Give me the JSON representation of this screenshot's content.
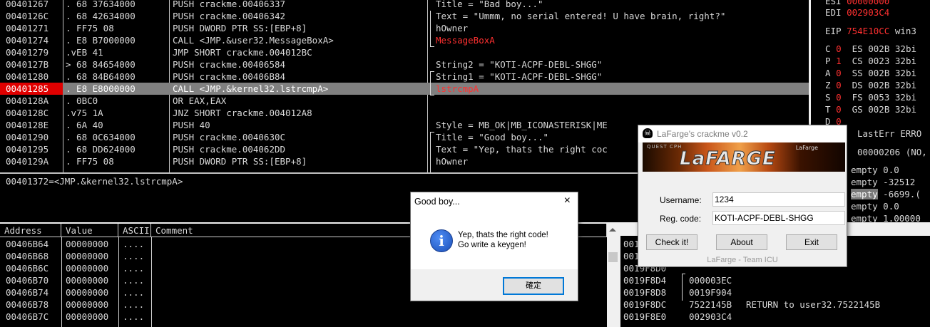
{
  "disasm": {
    "rows": [
      {
        "addr": "00401267",
        "bytes": ". 68 37634000",
        "instr": "PUSH crackme.00406337",
        "comment": "Title = \"Bad boy...\"",
        "comment_red": false
      },
      {
        "addr": "0040126C",
        "bytes": ". 68 42634000",
        "instr": "PUSH crackme.00406342",
        "comment": "Text = \"Ummm, no serial entered! U have brain, right?\"",
        "comment_red": false
      },
      {
        "addr": "00401271",
        "bytes": ". FF75 08",
        "instr": "PUSH DWORD PTR SS:[EBP+8]",
        "comment": "hOwner",
        "comment_red": false
      },
      {
        "addr": "00401274",
        "bytes": ". E8 B7000000",
        "instr": "CALL <JMP.&user32.MessageBoxA>",
        "comment": "MessageBoxA",
        "comment_red": true
      },
      {
        "addr": "00401279",
        "bytes": ".vEB 41",
        "instr": "JMP SHORT crackme.004012BC",
        "comment": "",
        "comment_red": false
      },
      {
        "addr": "0040127B",
        "bytes": "> 68 84654000",
        "instr": "PUSH crackme.00406584",
        "comment": "String2 = \"KOTI-ACPF-DEBL-SHGG\"",
        "comment_red": false
      },
      {
        "addr": "00401280",
        "bytes": ". 68 84B64000",
        "instr": "PUSH crackme.00406B84",
        "comment": "String1 = \"KOTI-ACPF-DEBL-SHGG\"",
        "comment_red": false
      },
      {
        "addr": "00401285",
        "bytes": ". E8 E8000000",
        "instr": "CALL <JMP.&kernel32.lstrcmpA>",
        "comment": "lstrcmpA",
        "comment_red": true
      },
      {
        "addr": "0040128A",
        "bytes": ". 0BC0",
        "instr": "OR EAX,EAX",
        "comment": "",
        "comment_red": false
      },
      {
        "addr": "0040128C",
        "bytes": ".v75 1A",
        "instr": "JNZ SHORT crackme.004012A8",
        "comment": "",
        "comment_red": false
      },
      {
        "addr": "0040128E",
        "bytes": ". 6A 40",
        "instr": "PUSH 40",
        "comment": "Style = MB_OK|MB_ICONASTERISK|ME",
        "comment_red": false
      },
      {
        "addr": "00401290",
        "bytes": ". 68 0C634000",
        "instr": "PUSH crackme.0040630C",
        "comment": "Title = \"Good boy...\"",
        "comment_red": false
      },
      {
        "addr": "00401295",
        "bytes": ". 68 DD624000",
        "instr": "PUSH crackme.004062DD",
        "comment": "Text = \"Yep, thats the right coc",
        "comment_red": false
      },
      {
        "addr": "0040129A",
        "bytes": ". FF75 08",
        "instr": "PUSH DWORD PTR SS:[EBP+8]",
        "comment": "hOwner",
        "comment_red": false
      }
    ],
    "selected_addr": "00401285"
  },
  "info_line": "00401372=<JMP.&kernel32.lstrcmpA>",
  "registers": {
    "lines": [
      {
        "label": "ESI",
        "value": "00000000"
      },
      {
        "label": "EDI",
        "value": "002903C4"
      },
      {
        "label": "EIP",
        "value": "754E10CC",
        "extra": "win3"
      }
    ],
    "flags": [
      {
        "f": "C",
        "v": "0",
        "seg": "ES",
        "sv": "002B",
        "bits": "32bi"
      },
      {
        "f": "P",
        "v": "1",
        "seg": "CS",
        "sv": "0023",
        "bits": "32bi"
      },
      {
        "f": "A",
        "v": "0",
        "seg": "SS",
        "sv": "002B",
        "bits": "32bi"
      },
      {
        "f": "Z",
        "v": "0",
        "seg": "DS",
        "sv": "002B",
        "bits": "32bi"
      },
      {
        "f": "S",
        "v": "0",
        "seg": "FS",
        "sv": "0053",
        "bits": "32bi"
      },
      {
        "f": "T",
        "v": "0",
        "seg": "GS",
        "sv": "002B",
        "bits": "32bi"
      },
      {
        "f": "D",
        "v": "0",
        "seg": "",
        "sv": "",
        "bits": ""
      }
    ],
    "lasterr": "LastErr ERRO",
    "efl": "00000206 (NO,",
    "fpu": [
      {
        "tag": "empty",
        "val": "0.0"
      },
      {
        "tag": "empty",
        "val": "-32512"
      },
      {
        "tag": "empty",
        "val": "-6699.("
      },
      {
        "tag": "empty",
        "val": "0.0"
      },
      {
        "tag": "empty",
        "val": "1.00000"
      }
    ],
    "tail": "..\""
  },
  "dump": {
    "headers": {
      "address": "Address",
      "value": "Value",
      "ascii": "ASCII",
      "comment": "Comment"
    },
    "rows": [
      {
        "addr": "00406B64",
        "val": "00000000",
        "ascii": "...."
      },
      {
        "addr": "00406B68",
        "val": "00000000",
        "ascii": "...."
      },
      {
        "addr": "00406B6C",
        "val": "00000000",
        "ascii": "...."
      },
      {
        "addr": "00406B70",
        "val": "00000000",
        "ascii": "...."
      },
      {
        "addr": "00406B74",
        "val": "00000000",
        "ascii": "...."
      },
      {
        "addr": "00406B78",
        "val": "00000000",
        "ascii": "...."
      },
      {
        "addr": "00406B7C",
        "val": "00000000",
        "ascii": "...."
      }
    ]
  },
  "stack": {
    "rows": [
      {
        "addr": "0019F8C8",
        "val": "",
        "cmt": ""
      },
      {
        "addr": "0019F8CC",
        "val": "",
        "cmt": ""
      },
      {
        "addr": "0019F8D0",
        "val": "",
        "cmt": ""
      },
      {
        "addr": "0019F8D4",
        "val": "000003EC",
        "cmt": ""
      },
      {
        "addr": "0019F8D8",
        "val": "0019F904",
        "cmt": ""
      },
      {
        "addr": "0019F8DC",
        "val": "7522145B",
        "cmt": "RETURN to user32.7522145B"
      },
      {
        "addr": "0019F8E0",
        "val": "002903C4",
        "cmt": ""
      }
    ]
  },
  "msgbox": {
    "title": "Good boy...",
    "close": "×",
    "icon": "i",
    "message": "Yep, thats the right code!\nGo write a keygen!",
    "ok_label": "確定"
  },
  "crackme": {
    "title": "LaFarge's crackme v0.2",
    "banner_group": "QUEST CPH",
    "banner_logo": "LaFARGE",
    "banner_small": "LaFarge",
    "username_label": "Username:",
    "username_value": "1234",
    "regcode_label": "Reg. code:",
    "regcode_value": "KOTI-ACPF-DEBL-SHGG",
    "btn_check": "Check it!",
    "btn_about": "About",
    "btn_exit": "Exit",
    "status": "LaFarge - Team ICU"
  },
  "colors": {
    "selected_addr_bg": "#e00000",
    "selected_row_bg": "#808080",
    "red_text": "#ff3030"
  }
}
